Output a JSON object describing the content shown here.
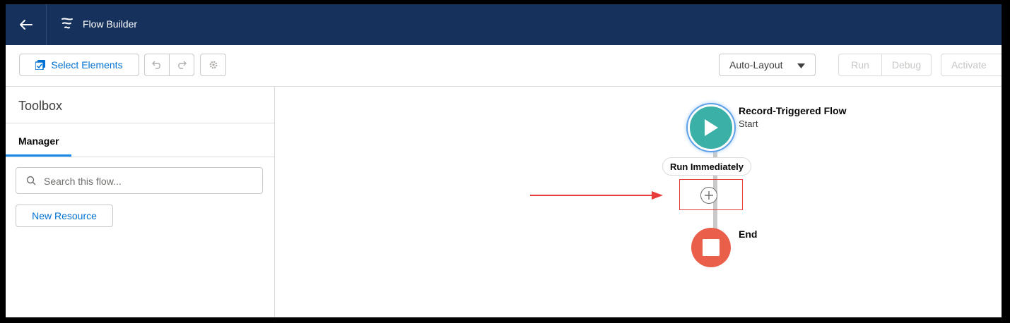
{
  "header": {
    "app_title": "Flow Builder",
    "back_icon": "arrow-left-icon",
    "app_icon": "flow-icon",
    "background": "#16325c"
  },
  "toolbar": {
    "select_elements_label": "Select Elements",
    "auto_layout_label": "Auto-Layout",
    "run_label": "Run",
    "debug_label": "Debug",
    "activate_label": "Activate"
  },
  "sidebar": {
    "title": "Toolbox",
    "tab_manager": "Manager",
    "search_placeholder": "Search this flow...",
    "new_resource_label": "New Resource"
  },
  "canvas": {
    "start_title": "Record-Triggered Flow",
    "start_subtitle": "Start",
    "run_immediately_label": "Run Immediately",
    "end_label": "End",
    "colors": {
      "start": "#3bb0a7",
      "end": "#ea5f4a",
      "annotation": "#e83c3c"
    }
  }
}
